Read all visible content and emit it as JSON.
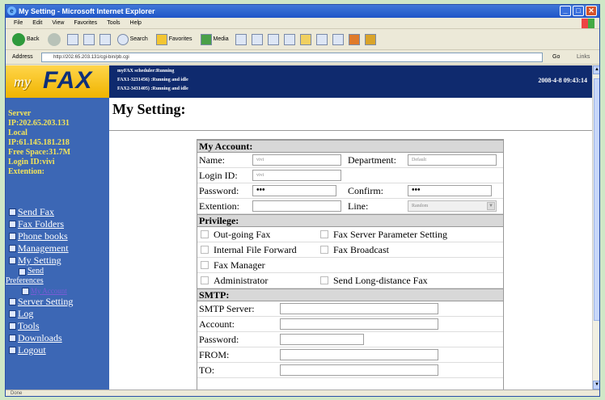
{
  "window": {
    "title": "My Setting - Microsoft Internet Explorer"
  },
  "menubar": [
    "File",
    "Edit",
    "View",
    "Favorites",
    "Tools",
    "Help"
  ],
  "toolbar": {
    "back_label": "Back",
    "search_label": "Search",
    "favorites_label": "Favorites",
    "media_label": "Media"
  },
  "address": {
    "label": "Address",
    "url": "http://202.65.203.131/cgi-bin/pb.cgi",
    "go_label": "Go",
    "links_label": "Links"
  },
  "header": {
    "logo_my": "my",
    "logo_fax": "FAX",
    "status_lines": [
      "myFAX scheduler:Running",
      "FAX1-3231456)  :Running and idle",
      "FAX2-3431405)  :Running and idle"
    ],
    "datetime": "2008-4-8 09:43:14"
  },
  "sidebar": {
    "info": [
      "Server",
      "IP:202.65.203.131",
      "Local",
      "IP:61.145.181.218",
      "Free Space:31.7M",
      "Login ID:vivi",
      "Extention:"
    ],
    "nav": [
      {
        "label": "Send Fax",
        "icon": "send-fax-icon"
      },
      {
        "label": "Fax Folders",
        "icon": "folder-icon"
      },
      {
        "label": "Phone books",
        "icon": "phonebook-icon"
      },
      {
        "label": "Management",
        "icon": "management-icon"
      },
      {
        "label": "My Setting",
        "icon": "settings-icon"
      },
      {
        "label": "Send",
        "icon": "send-icon"
      },
      {
        "label": "Preferences",
        "icon": ""
      },
      {
        "label": "My Account",
        "icon": "account-icon"
      },
      {
        "label": "Server Setting",
        "icon": "server-icon"
      },
      {
        "label": "Log",
        "icon": "log-icon"
      },
      {
        "label": "Tools",
        "icon": "tools-icon"
      },
      {
        "label": "Downloads",
        "icon": "downloads-icon"
      },
      {
        "label": "Logout",
        "icon": "logout-icon"
      }
    ]
  },
  "main": {
    "title": "My Setting:"
  },
  "account": {
    "heading": "My Account:",
    "name_label": "Name:",
    "name_value": "vivi",
    "department_label": "Department:",
    "department_value": "Default",
    "login_label": "Login ID:",
    "login_value": "vivi",
    "password_label": "Password:",
    "password_value": "•••",
    "confirm_label": "Confirm:",
    "confirm_value": "•••",
    "extention_label": "Extention:",
    "extention_value": "",
    "line_label": "Line:",
    "line_value": "Random"
  },
  "privilege": {
    "heading": "Privilege:",
    "items": [
      "Out-going Fax",
      "Fax Server Parameter Setting",
      "Internal File Forward",
      "Fax Broadcast",
      "Fax Manager",
      "Administrator",
      "Send Long-distance Fax"
    ]
  },
  "smtp": {
    "heading": "SMTP:",
    "server_label": "SMTP Server:",
    "account_label": "Account:",
    "password_label": "Password:",
    "from_label": "FROM:",
    "to_label": "TO:"
  },
  "status": {
    "text": "Done"
  }
}
